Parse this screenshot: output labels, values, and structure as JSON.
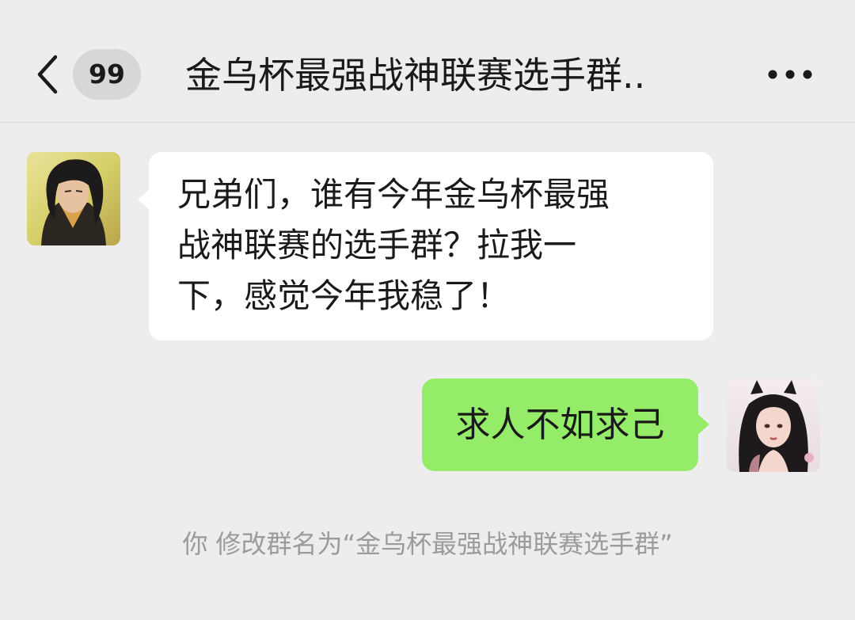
{
  "header": {
    "back_icon": "chevron-left-icon",
    "unread_count": "99",
    "title": "金乌杯最强战神联赛选手群..",
    "more_icon": "more-dots-icon"
  },
  "messages": [
    {
      "side": "left",
      "avatar": "male-warrior-avatar",
      "lines": [
        "兄弟们，谁有今年金乌杯最强",
        "战神联赛的选手群？拉我一",
        "下，感觉今年我稳了！"
      ]
    },
    {
      "side": "right",
      "avatar": "female-avatar",
      "text": "求人不如求己"
    }
  ],
  "system_message": "你 修改群名为“金乌杯最强战神联赛选手群”",
  "colors": {
    "background": "#ededed",
    "received_bubble": "#ffffff",
    "sent_bubble": "#95ec69",
    "badge": "#d7d7d7",
    "system_text": "#9b9b9b"
  }
}
